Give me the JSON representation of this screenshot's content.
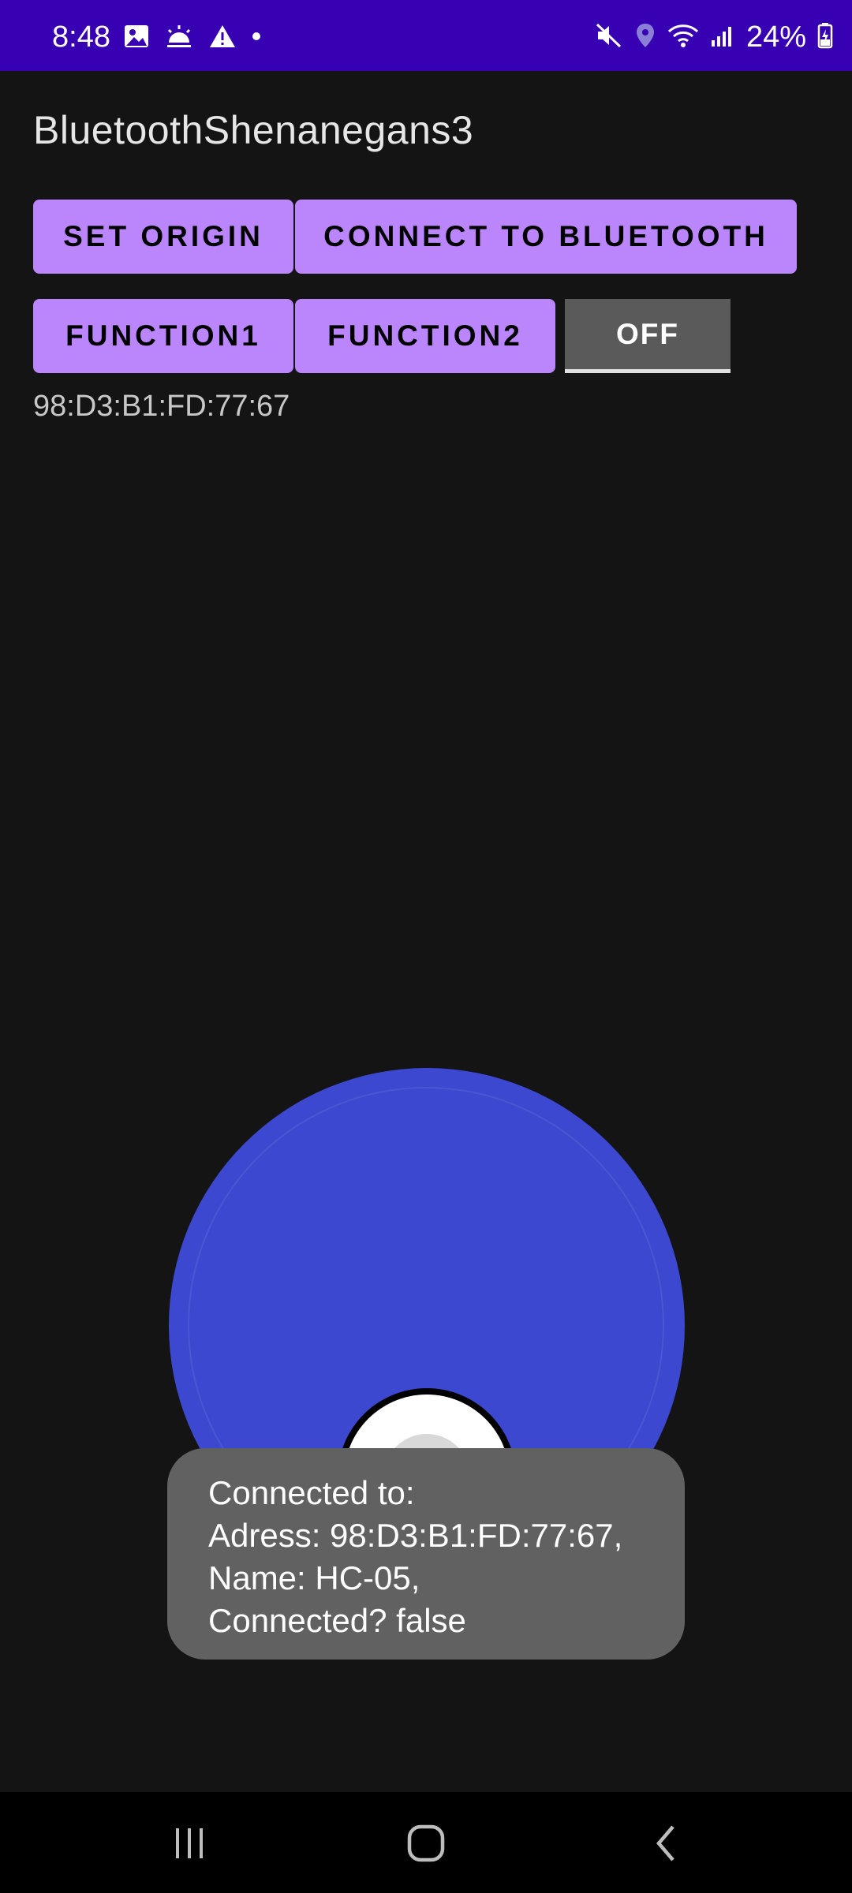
{
  "status_bar": {
    "time": "8:48",
    "left_icons": [
      "gallery-icon",
      "weather-icon",
      "warning-icon",
      "dot-icon"
    ],
    "right_icons": [
      "mute-icon",
      "location-icon",
      "wifi-icon",
      "signal-icon",
      "battery-icon"
    ],
    "battery": "24%",
    "background": "#3700b3"
  },
  "app": {
    "title": "BluetoothShenanegans3"
  },
  "buttons": {
    "set_origin": "SET ORIGIN",
    "connect": "CONNECT TO BLUETOOTH",
    "function1": "FUNCTION1",
    "function2": "FUNCTION2",
    "toggle": "OFF",
    "accent": "#bb86fc"
  },
  "device_address": "98:D3:B1:FD:77:67",
  "joystick": {
    "base_color": "#3c48cf"
  },
  "toast": {
    "lines": [
      "Connected to:",
      "Adress: 98:D3:B1:FD:77:67,",
      "Name: HC-05,",
      "Connected? false"
    ]
  },
  "nav_bar": {
    "icons": [
      "recents-icon",
      "home-icon",
      "back-icon"
    ]
  }
}
